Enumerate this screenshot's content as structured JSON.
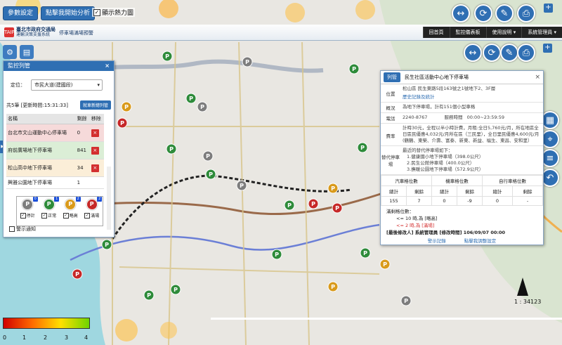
{
  "toolbar": {
    "param_label": "參數設定",
    "analysis_label": "點擊我開始分析",
    "heatmap_label": "顯示熱力圖",
    "heatmap_checked": "✓"
  },
  "header": {
    "logo_mark": "TAIPEI",
    "logo_line1": "臺北市政府交通局",
    "logo_line2": "運輸決策支援系統",
    "system_name": "停車場滿場預警",
    "nav": [
      "回首頁",
      "監控儀表板",
      "使用說明 ▾",
      "系統管理員 ▾"
    ]
  },
  "panel": {
    "title": "監控列管",
    "close": "×",
    "location_label": "定位：",
    "location_value": "市民大道(建國段)",
    "count_text": "共5筆 [更新時間:15:31:33]",
    "refresh_label": "就車新總列管",
    "columns": [
      "名稱",
      "剩餘",
      "移除"
    ],
    "rows": [
      {
        "name": "台北市文山運動中心停車場",
        "remain": "0"
      },
      {
        "name": "府前廣場地下停車場",
        "remain": "841"
      },
      {
        "name": "松山高中地下停車場",
        "remain": "34"
      },
      {
        "name": "興雅公園地下停車場",
        "remain": "1"
      }
    ],
    "remove_icon": "×",
    "legend": [
      {
        "letter": "P",
        "count": "0",
        "label": "停計",
        "color": "#7d7d7d"
      },
      {
        "letter": "P",
        "count": "1",
        "label": "正常",
        "color": "#2e8b3a"
      },
      {
        "letter": "P",
        "count": "2",
        "label": "略高",
        "color": "#d99a1b"
      },
      {
        "letter": "P",
        "count": "2",
        "label": "滿場",
        "color": "#c62828"
      }
    ],
    "check": "✓",
    "notify_label": "警示通知"
  },
  "popup": {
    "tab": "列管",
    "title": "民生社區活動中心地下停車場",
    "close": "×",
    "location_key": "位置",
    "location_val": "松山區 民生東路5段163號之1號地下2、3F層",
    "history_link": "歷史記錄及統計",
    "overview_key": "概況",
    "overview_val": "為地下停車場，計有151個小型車格",
    "phone_key": "電話",
    "phone_val": "2240-8767",
    "hours_label": "服務時間",
    "hours_val": "00:00~23:59:59",
    "fee_key": "費率",
    "fee_val": "計時30元，全程以半小時計費，月租:全日5,760元/月，所在地區全日區民優惠4,032元/月所在區（三民里），全日里民優惠4,600元/月(鶴鶴、東榮、介壽、富泰、新東、新益、福生、東昌、安和里）",
    "alt_key": "替代停車場",
    "alt_intro": "最近的替代停車場如下：",
    "alt_list": [
      "1.健康國小地下停車場（398.0公尺）",
      "2.民生公館停車場（400.0公尺）",
      "3.撫暖公園地下停車場（572.9公尺）"
    ],
    "space_headers": [
      "汽車格位數",
      "機車格位數",
      "自行車格位數"
    ],
    "space_sub": [
      "總計",
      "剩餘",
      "總計",
      "剩餘",
      "總計",
      "剩餘"
    ],
    "space_vals": [
      "155",
      "7",
      "0",
      "-9",
      "0",
      "-"
    ],
    "threshold_title": "滿剩格位數：",
    "threshold_1": "<= 10 時,為 [略高]",
    "threshold_2": "<= 2 時,為 [滿場]",
    "modifier": "[最後修改人] 系統管理員    [修改時間] 106/09/07 00:00",
    "link_warn": "警示記錄",
    "link_set": "點擊我調整設定"
  },
  "map": {
    "scale": "1 : 34123",
    "colorbar_ticks": [
      "0",
      "1",
      "2",
      "3",
      "4"
    ]
  }
}
